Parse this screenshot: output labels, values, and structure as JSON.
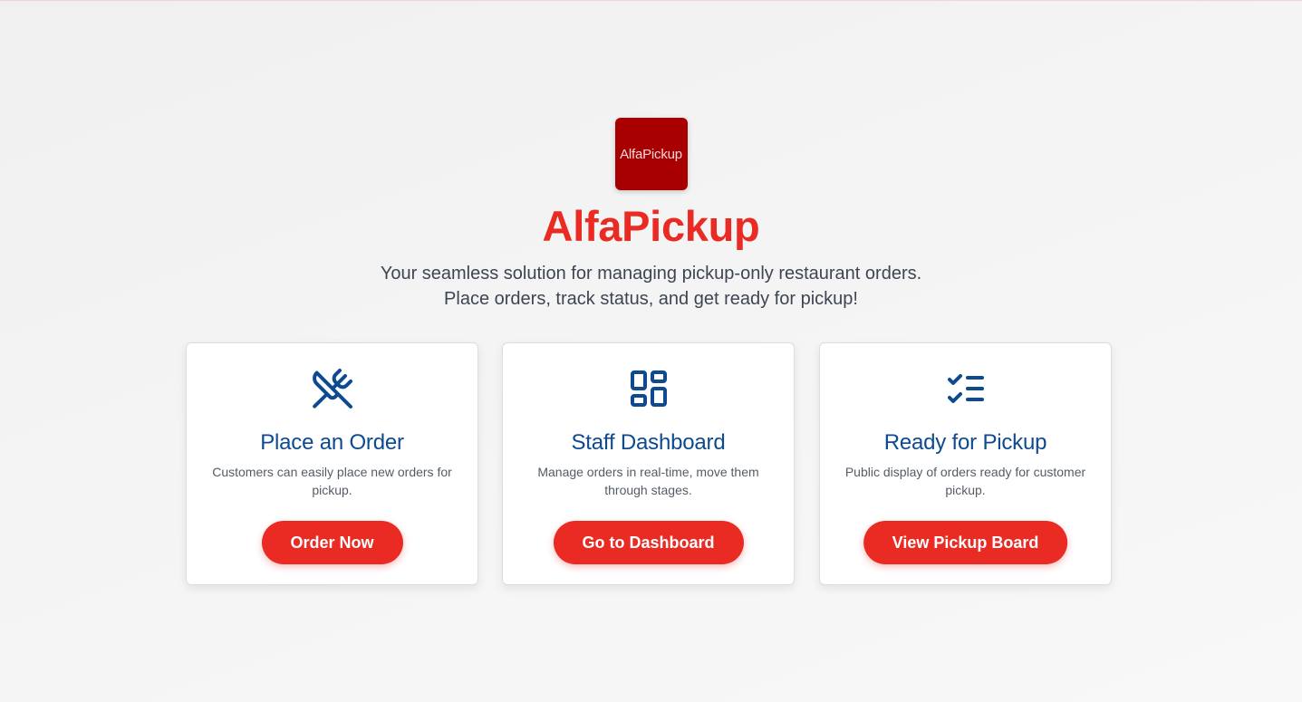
{
  "app": {
    "logo_text": "AlfaPickup",
    "title": "AlfaPickup",
    "tagline_line1": "Your seamless solution for managing pickup-only restaurant orders.",
    "tagline_line2": "Place orders, track status, and get ready for pickup!"
  },
  "cards": [
    {
      "icon": "utensils-crossed-icon",
      "title": "Place an Order",
      "description": "Customers can easily place new orders for pickup.",
      "button_label": "Order Now"
    },
    {
      "icon": "layout-dashboard-icon",
      "title": "Staff Dashboard",
      "description": "Manage orders in real-time, move them through stages.",
      "button_label": "Go to Dashboard"
    },
    {
      "icon": "list-checks-icon",
      "title": "Ready for Pickup",
      "description": "Public display of orders ready for customer pickup.",
      "button_label": "View Pickup Board"
    }
  ],
  "colors": {
    "brand_red": "#ea2b24",
    "logo_bg": "#a80000",
    "card_title_blue": "#0d4a8f",
    "tagline_gray": "#3e4552",
    "description_gray": "#555c66"
  }
}
